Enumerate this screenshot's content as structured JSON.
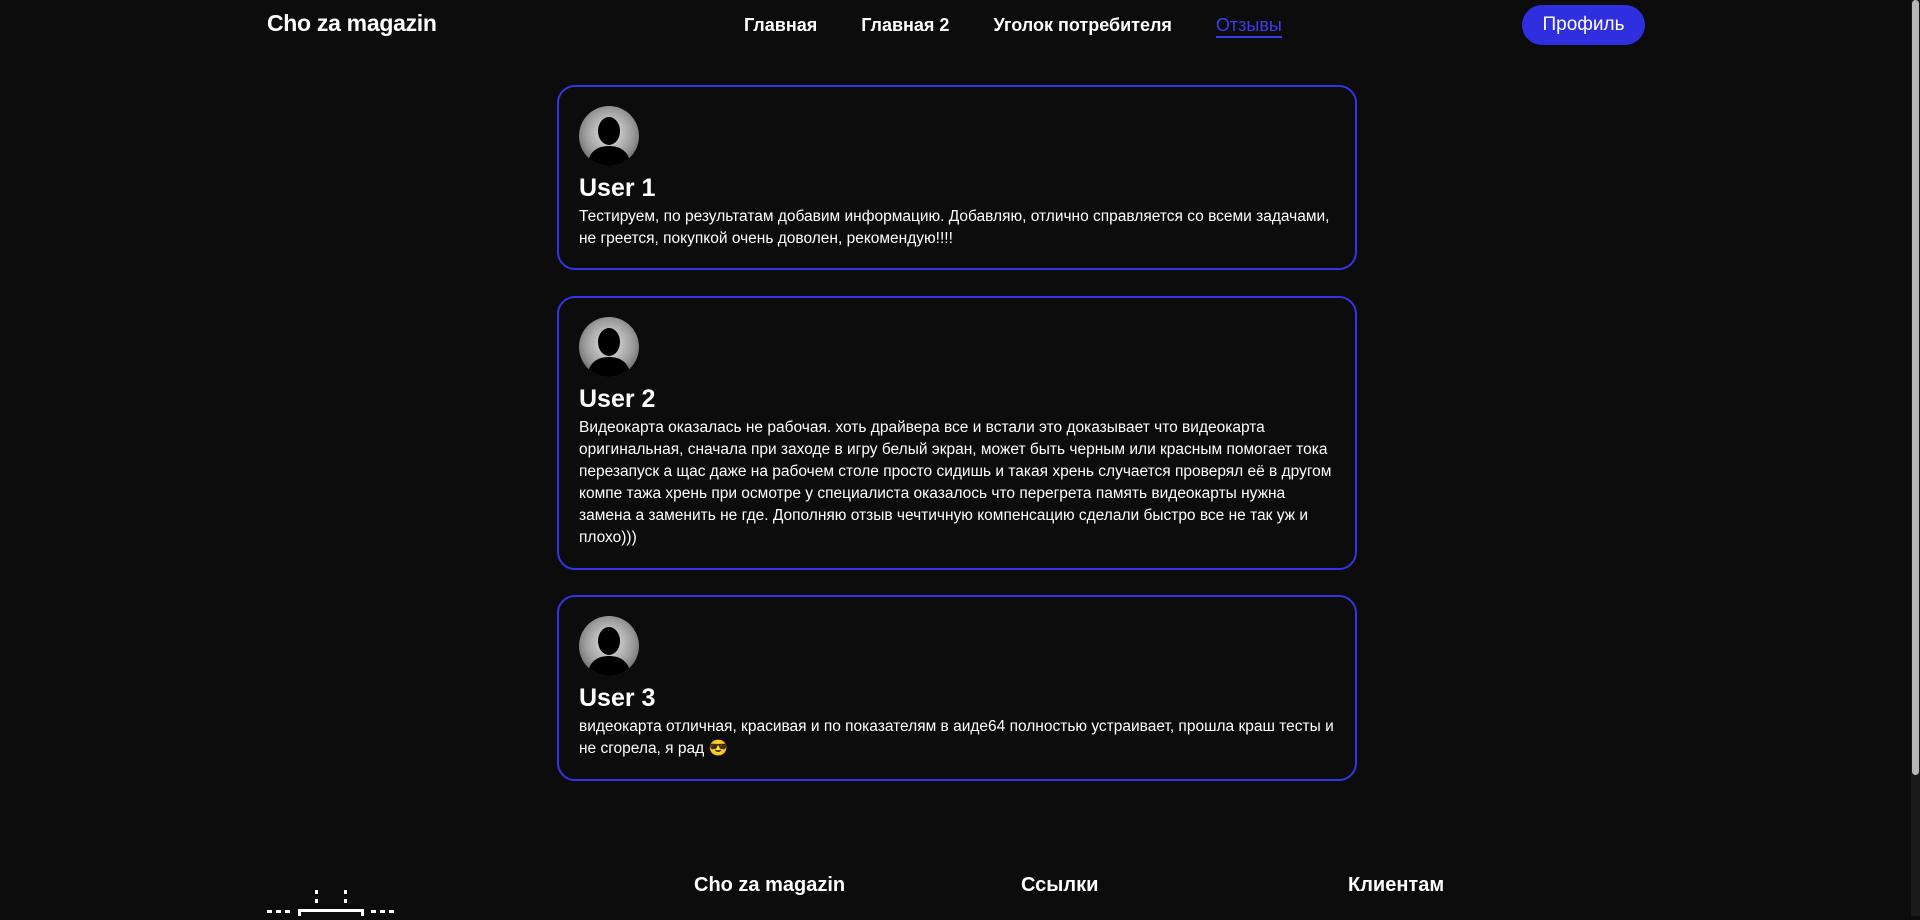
{
  "header": {
    "logo": "Cho za magazin",
    "nav": [
      {
        "label": "Главная",
        "active": false
      },
      {
        "label": "Главная 2",
        "active": false
      },
      {
        "label": "Уголок потребителя",
        "active": false
      },
      {
        "label": "Отзывы",
        "active": true
      }
    ],
    "profile_label": "Профиль"
  },
  "reviews": [
    {
      "user": "User 1",
      "text": "Тестируем, по результатам добавим информацию. Добавляю, отлично справляется со всеми задачами, не греется, покупкой очень доволен, рекомендую!!!!"
    },
    {
      "user": "User 2",
      "text": "Видеокарта оказалась не рабочая. хоть драйвера все и встали это доказывает что видеокарта оригинальная, сначала при заходе в игру белый экран, может быть черным или красным помогает тока перезапуск а щас даже на рабочем столе просто сидишь и такая хрень случается проверял её в другом компе тажа хрень при осмотре у специалиста оказалось что перегрета память видеокарты нужна замена а заменить не где. Дополняю отзыв чечтичную компенсацию сделали быстро все не так уж и плохо)))"
    },
    {
      "user": "User 3",
      "text": "видеокарта отличная, красивая и по показателям в аиде64 полностью устраивает, прошла краш тесты и не сгорела, я рад 😎"
    }
  ],
  "footer": {
    "col1": "Cho za magazin",
    "col2": "Ссылки",
    "col3": "Клиентам"
  },
  "colors": {
    "accent": "#3434e6",
    "background": "#0c0c0c"
  }
}
